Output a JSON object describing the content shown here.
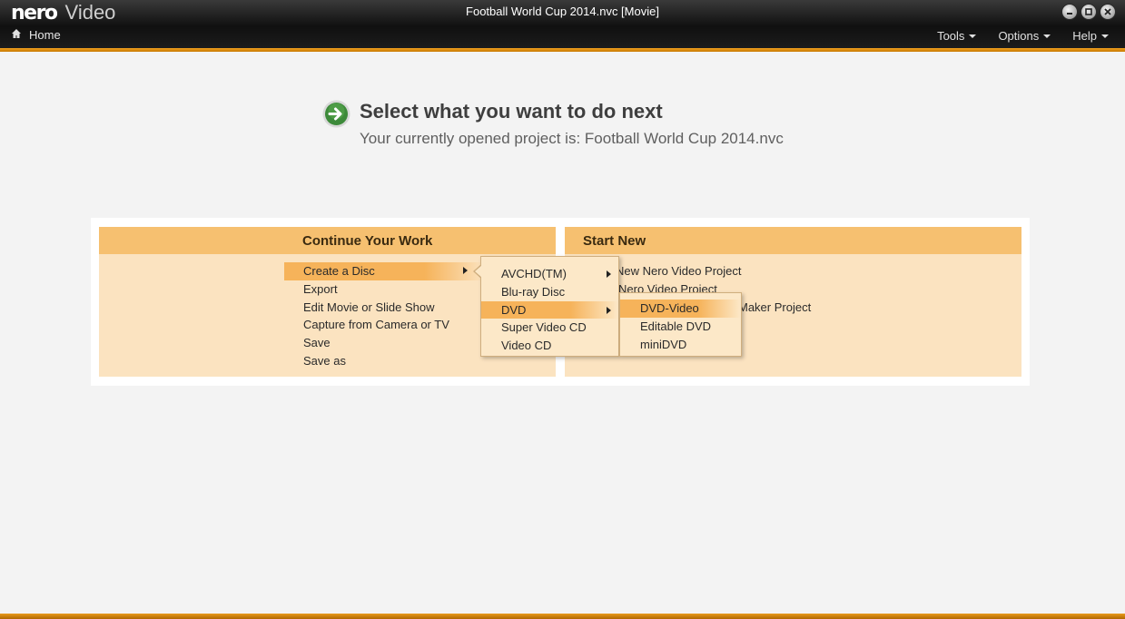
{
  "app": {
    "brand": "nero",
    "product": "Video",
    "document_title": "Football World Cup 2014.nvc [Movie]",
    "accent_color": "#f0a020"
  },
  "nav": {
    "home_label": "Home",
    "menus": [
      {
        "label": "Tools"
      },
      {
        "label": "Options"
      },
      {
        "label": "Help"
      }
    ]
  },
  "window_controls": [
    "minimize-icon",
    "maximize-icon",
    "close-icon"
  ],
  "heading": {
    "title": "Select what you want to do next",
    "subtitle": "Your currently opened project is: Football World Cup 2014.nvc"
  },
  "continue_panel": {
    "title": "Continue Your Work",
    "items": [
      {
        "label": "Create a Disc"
      },
      {
        "label": "Export"
      },
      {
        "label": "Edit Movie or Slide Show"
      },
      {
        "label": "Capture from Camera or TV"
      },
      {
        "label": "Save"
      },
      {
        "label": "Save as"
      }
    ]
  },
  "start_panel": {
    "title": "Start New",
    "items": [
      {
        "label": "New Nero Video Project"
      },
      {
        "label": "Nero Video Project"
      },
      {
        "label": "Maker Project"
      }
    ]
  },
  "disc_menu": {
    "items": [
      {
        "label": "AVCHD(TM)"
      },
      {
        "label": "Blu-ray Disc"
      },
      {
        "label": "DVD"
      },
      {
        "label": "Super Video CD"
      },
      {
        "label": "Video CD"
      }
    ]
  },
  "dvd_menu": {
    "items": [
      {
        "label": "DVD-Video"
      },
      {
        "label": "Editable DVD"
      },
      {
        "label": "miniDVD"
      }
    ]
  }
}
